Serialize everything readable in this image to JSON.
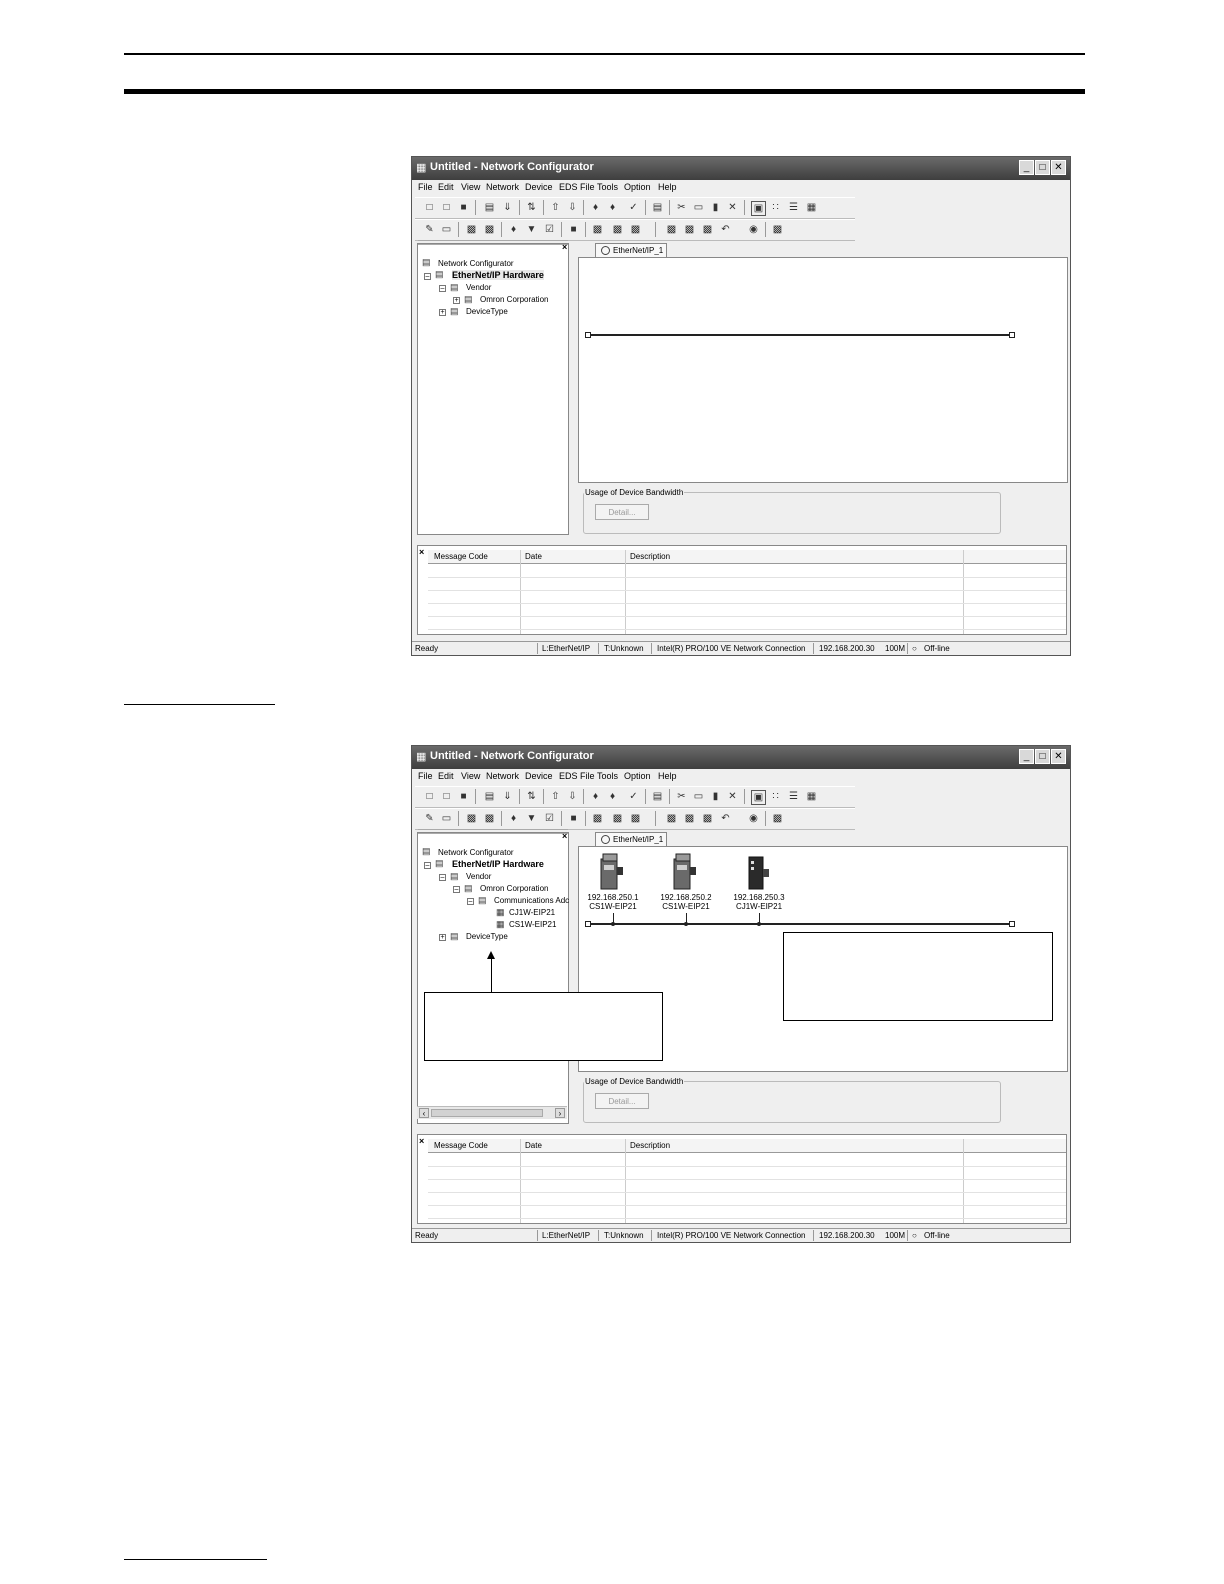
{
  "window": {
    "title": "Untitled - Network Configurator",
    "menu": [
      "File",
      "Edit",
      "View",
      "Network",
      "Device",
      "EDS File",
      "Tools",
      "Option",
      "Help"
    ],
    "tab_label": "EtherNet/IP_1",
    "bandwidth_label": "Usage of Device Bandwidth",
    "detail_button": "Detail...",
    "message_columns": [
      "Message Code",
      "Date",
      "Description"
    ],
    "status": {
      "ready": "Ready",
      "layer": "L:EtherNet/IP",
      "type": "T:Unknown",
      "adapter": "Intel(R) PRO/100 VE Network Connection",
      "ip": "192.168.200.30",
      "speed": "100M",
      "mode": "Off-line"
    }
  },
  "tree1": {
    "root": "Network Configurator",
    "hardware": "EtherNet/IP Hardware",
    "vendor": "Vendor",
    "omron": "Omron Corporation",
    "devicetype": "DeviceType"
  },
  "tree2": {
    "root": "Network Configurator",
    "hardware": "EtherNet/IP Hardware",
    "vendor": "Vendor",
    "omron": "Omron Corporation",
    "comms": "Communications Adc",
    "item1": "CJ1W-EIP21",
    "item2": "CS1W-EIP21",
    "devicetype": "DeviceType"
  },
  "devices": [
    {
      "ip": "192.168.250.1",
      "model": "CS1W-EIP21"
    },
    {
      "ip": "192.168.250.2",
      "model": "CS1W-EIP21"
    },
    {
      "ip": "192.168.250.3",
      "model": "CJ1W-EIP21"
    }
  ],
  "icons": {
    "app": "network-configurator-icon",
    "minimize": "minimize-icon",
    "maximize": "maximize-icon",
    "close": "close-icon"
  }
}
